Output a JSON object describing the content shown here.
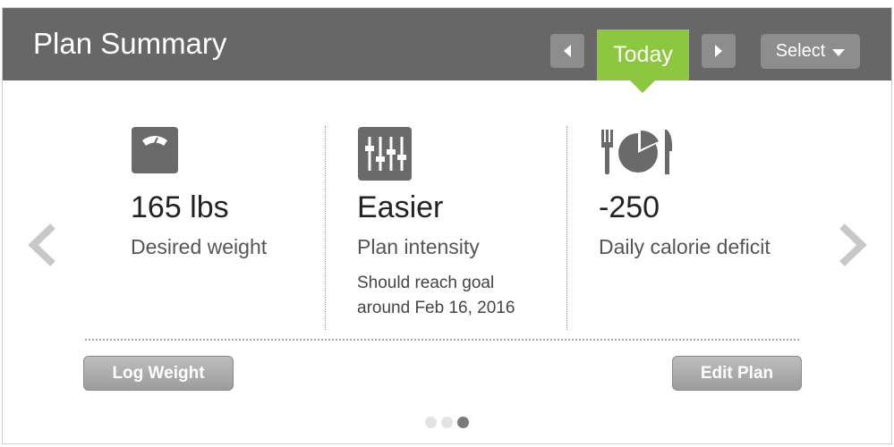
{
  "header": {
    "title": "Plan Summary",
    "today_label": "Today",
    "select_label": "Select"
  },
  "colors": {
    "header_bg": "#676767",
    "accent": "#8dc63f",
    "button_gray": "#8d8d8d"
  },
  "stats": [
    {
      "icon": "scale-icon",
      "value": "165 lbs",
      "label": "Desired weight"
    },
    {
      "icon": "sliders-icon",
      "value": "Easier",
      "label": "Plan intensity",
      "note_line1": "Should reach goal",
      "note_line2": "around Feb 16, 2016"
    },
    {
      "icon": "fork-plate-knife-icon",
      "value": "-250",
      "label": "Daily calorie deficit"
    }
  ],
  "actions": {
    "log_weight": "Log Weight",
    "edit_plan": "Edit Plan"
  },
  "pagination": {
    "total": 3,
    "active": 3
  }
}
